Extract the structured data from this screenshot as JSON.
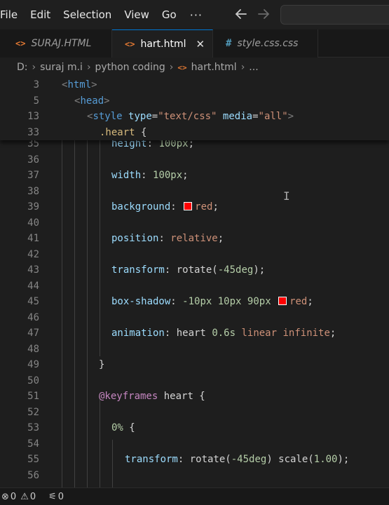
{
  "menu": [
    "File",
    "Edit",
    "Selection",
    "View",
    "Go"
  ],
  "menu_more": "···",
  "tabs": [
    {
      "label": "SURAJ.HTML",
      "icon": "html-file-icon",
      "active": false,
      "italic": true
    },
    {
      "label": "hart.html",
      "icon": "html-file-icon",
      "active": true,
      "italic": false,
      "close": "✕"
    },
    {
      "label": "style.css.css",
      "icon": "css-file-icon",
      "active": false,
      "italic": true
    }
  ],
  "breadcrumb": [
    "D:",
    "suraj m.i",
    "python coding",
    "hart.html",
    "..."
  ],
  "sticky_lines": [
    {
      "n": "3",
      "indent": 0,
      "code": "<html>"
    },
    {
      "n": "5",
      "indent": 1,
      "code": "<head>"
    },
    {
      "n": "13",
      "indent": 2,
      "code": "<style type=\"text/css\" media=\"all\">"
    },
    {
      "n": "33",
      "indent": 3,
      "code": ".heart {"
    }
  ],
  "lines": [
    {
      "n": "35",
      "code": "height: 100px;"
    },
    {
      "n": "36",
      "code": ""
    },
    {
      "n": "37",
      "code": "width: 100px;"
    },
    {
      "n": "38",
      "code": ""
    },
    {
      "n": "39",
      "code": "background: red;"
    },
    {
      "n": "40",
      "code": ""
    },
    {
      "n": "41",
      "code": "position: relative;"
    },
    {
      "n": "42",
      "code": ""
    },
    {
      "n": "43",
      "code": "transform: rotate(-45deg);"
    },
    {
      "n": "44",
      "code": ""
    },
    {
      "n": "45",
      "code": "box-shadow: -10px 10px 90px red;"
    },
    {
      "n": "46",
      "code": ""
    },
    {
      "n": "47",
      "code": "animation: heart 0.6s linear infinite;"
    },
    {
      "n": "48",
      "code": ""
    },
    {
      "n": "49",
      "code": "}"
    },
    {
      "n": "50",
      "code": ""
    },
    {
      "n": "51",
      "code": "@keyframes heart {"
    },
    {
      "n": "52",
      "code": ""
    },
    {
      "n": "53",
      "code": "0% {"
    },
    {
      "n": "54",
      "code": ""
    },
    {
      "n": "55",
      "code": "transform: rotate(-45deg) scale(1.00);"
    },
    {
      "n": "56",
      "code": ""
    }
  ],
  "status": {
    "errors": "0",
    "warnings": "0",
    "ports": "0"
  },
  "colors": {
    "accent": "#0078d4",
    "swatch": "#ff0000",
    "editor_bg": "#1e1e1e"
  }
}
